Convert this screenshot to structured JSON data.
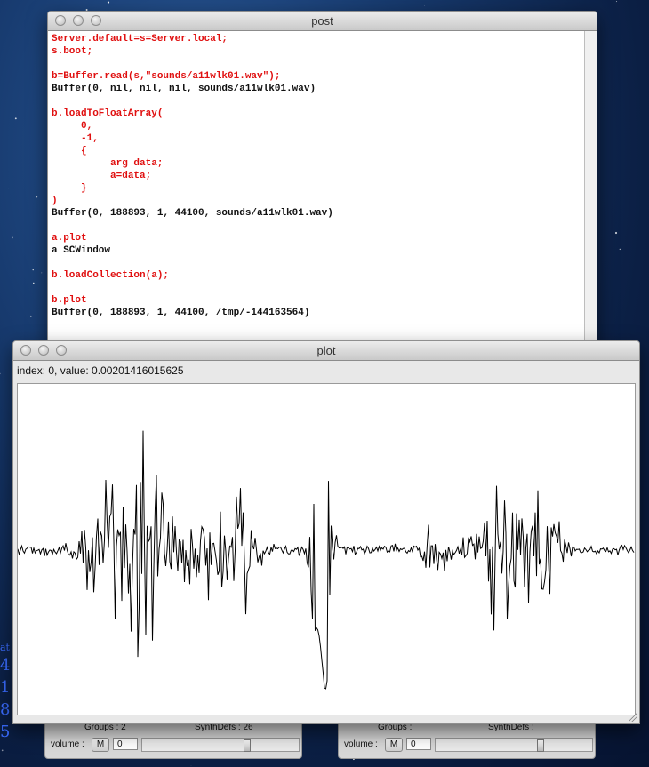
{
  "post_window": {
    "title": "post",
    "lines": [
      {
        "text": "Server.default=s=Server.local;",
        "color": "red"
      },
      {
        "text": "s.boot;",
        "color": "red"
      },
      {
        "text": "",
        "color": "black"
      },
      {
        "text": "b=Buffer.read(s,\"sounds/a11wlk01.wav\");",
        "color": "red"
      },
      {
        "text": "Buffer(0, nil, nil, nil, sounds/a11wlk01.wav)",
        "color": "black"
      },
      {
        "text": "",
        "color": "black"
      },
      {
        "text": "b.loadToFloatArray(",
        "color": "red"
      },
      {
        "text": "     0,",
        "color": "red"
      },
      {
        "text": "     -1,",
        "color": "red"
      },
      {
        "text": "     {",
        "color": "red"
      },
      {
        "text": "          arg data;",
        "color": "red"
      },
      {
        "text": "          a=data;",
        "color": "red"
      },
      {
        "text": "     }",
        "color": "red"
      },
      {
        "text": ")",
        "color": "red"
      },
      {
        "text": "Buffer(0, 188893, 1, 44100, sounds/a11wlk01.wav)",
        "color": "black"
      },
      {
        "text": "",
        "color": "black"
      },
      {
        "text": "a.plot",
        "color": "red"
      },
      {
        "text": "a SCWindow",
        "color": "black"
      },
      {
        "text": "",
        "color": "black"
      },
      {
        "text": "b.loadCollection(a);",
        "color": "red"
      },
      {
        "text": "",
        "color": "black"
      },
      {
        "text": "b.plot",
        "color": "red"
      },
      {
        "text": "Buffer(0, 188893, 1, 44100, /tmp/-144163564)",
        "color": "black"
      }
    ]
  },
  "plot_window": {
    "title": "plot",
    "info": "index: 0, value: 0.00201416015625"
  },
  "server_left": {
    "groups": "Groups : 2",
    "synthdefs": "SynthDefs : 26",
    "volume_label": "volume :",
    "mute_label": "M",
    "volume_value": "0",
    "slider_level": 0.68
  },
  "server_right": {
    "groups": "Groups :",
    "synthdefs": "SynthDefs :",
    "volume_label": "volume :",
    "mute_label": "M",
    "volume_value": "0",
    "slider_level": 0.68
  },
  "side_text": [
    "at",
    "4",
    "1",
    "8",
    "5"
  ],
  "colors": {
    "code_red": "#e01010",
    "link_blue": "#3a6cff"
  }
}
